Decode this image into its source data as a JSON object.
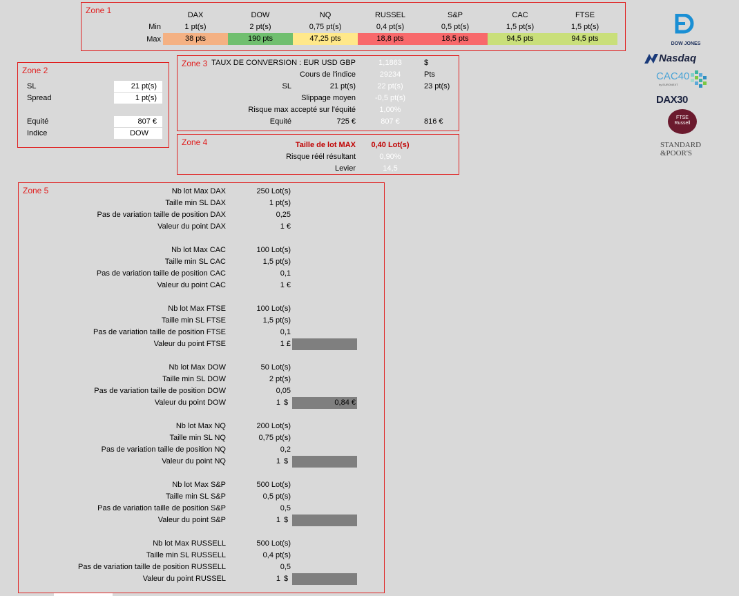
{
  "zone1": {
    "title": "Zone 1",
    "min_label": "Min",
    "max_label": "Max",
    "columns": [
      {
        "name": "DAX",
        "min": "1 pt(s)",
        "max": "38 pts",
        "color": "#f4b183"
      },
      {
        "name": "DOW",
        "min": "2 pt(s)",
        "max": "190 pts",
        "color": "#70bf6f"
      },
      {
        "name": "NQ",
        "min": "0,75 pt(s)",
        "max": "47,25 pts",
        "color": "#ffe88a"
      },
      {
        "name": "RUSSEL",
        "min": "0,4 pt(s)",
        "max": "18,8 pts",
        "color": "#f8696b"
      },
      {
        "name": "S&P",
        "min": "0,5 pt(s)",
        "max": "18,5 pts",
        "color": "#f8696b"
      },
      {
        "name": "CAC",
        "min": "1,5 pt(s)",
        "max": "94,5 pts",
        "color": "#c9df7a"
      },
      {
        "name": "FTSE",
        "min": "1,5 pt(s)",
        "max": "94,5 pts",
        "color": "#c9df7a"
      }
    ]
  },
  "zone2": {
    "title": "Zone 2",
    "sl_label": "SL",
    "sl_value": "21 pt(s)",
    "spread_label": "Spread",
    "spread_value": "1 pt(s)",
    "equite_label": "Equité",
    "equite_value": "807 €",
    "indice_label": "Indice",
    "indice_value": "DOW"
  },
  "zone3": {
    "title": "Zone 3",
    "conv_label": "TAUX DE CONVERSION : EUR USD GBP",
    "conv_value": "1,1863",
    "conv_unit": "$",
    "cours_label": "Cours de l'indice",
    "cours_value": "29234",
    "cours_unit": "Pts",
    "sl_label": "SL",
    "sl_a": "21 pt(s)",
    "sl_b": "22 pt(s)",
    "sl_c": "23 pt(s)",
    "slip_label": "Slippage moyen",
    "slip_value": "-0,5 pt(s)",
    "risk_label": "Risque max accepté sur l'équité",
    "risk_value": "1,00%",
    "eq_label": "Equité",
    "eq_a": "725 €",
    "eq_b": "807 €",
    "eq_c": "816 €"
  },
  "zone4": {
    "title": "Zone 4",
    "lot_label": "Taille de lot MAX",
    "lot_value": "0,40 Lot(s)",
    "risk_label": "Risque réél résultant",
    "risk_value": "0,90%",
    "lev_label": "Levier",
    "lev_value": "14,5"
  },
  "zone5": {
    "title": "Zone 5",
    "groups": [
      {
        "rows": [
          {
            "label": "Nb lot Max DAX",
            "value": "250 Lot(s)"
          },
          {
            "label": "Taille min SL DAX",
            "value": "1 pt(s)"
          },
          {
            "label": "Pas de variation taille de position DAX",
            "value": "0,25"
          },
          {
            "label": "Valeur du point DAX",
            "value": "1 €",
            "unit": "",
            "extra": ""
          }
        ],
        "gray": false
      },
      {
        "rows": [
          {
            "label": "Nb lot Max CAC",
            "value": "100 Lot(s)"
          },
          {
            "label": "Taille min SL CAC",
            "value": "1,5 pt(s)"
          },
          {
            "label": "Pas de variation taille de position CAC",
            "value": "0,1"
          },
          {
            "label": "Valeur du point CAC",
            "value": "1 €",
            "unit": "",
            "extra": ""
          }
        ],
        "gray": false
      },
      {
        "rows": [
          {
            "label": "Nb lot Max FTSE",
            "value": "100 Lot(s)"
          },
          {
            "label": "Taille min SL FTSE",
            "value": "1,5 pt(s)"
          },
          {
            "label": "Pas de variation taille de position FTSE",
            "value": "0,1"
          },
          {
            "label": "Valeur du point FTSE",
            "value": "1 £",
            "unit": "",
            "extra": ""
          }
        ],
        "gray": true
      },
      {
        "rows": [
          {
            "label": "Nb lot Max DOW",
            "value": "50 Lot(s)"
          },
          {
            "label": "Taille min SL DOW",
            "value": "2 pt(s)"
          },
          {
            "label": "Pas de variation taille de position DOW",
            "value": "0,05"
          },
          {
            "label": "Valeur du point DOW",
            "value": "1",
            "unit": "$",
            "extra": "0,84 €"
          }
        ],
        "gray": true
      },
      {
        "rows": [
          {
            "label": "Nb lot Max NQ",
            "value": "200 Lot(s)"
          },
          {
            "label": "Taille min SL NQ",
            "value": "0,75 pt(s)"
          },
          {
            "label": "Pas de variation taille de position NQ",
            "value": "0,2"
          },
          {
            "label": "Valeur du point NQ",
            "value": "1",
            "unit": "$",
            "extra": ""
          }
        ],
        "gray": true
      },
      {
        "rows": [
          {
            "label": "Nb lot Max S&P",
            "value": "500 Lot(s)"
          },
          {
            "label": "Taille min SL S&P",
            "value": "0,5 pt(s)"
          },
          {
            "label": "Pas de variation taille de position S&P",
            "value": "0,5"
          },
          {
            "label": "Valeur du point S&P",
            "value": "1",
            "unit": "$",
            "extra": ""
          }
        ],
        "gray": true
      },
      {
        "rows": [
          {
            "label": "Nb lot Max RUSSELL",
            "value": "500 Lot(s)"
          },
          {
            "label": "Taille min SL RUSSELL",
            "value": "0,4 pt(s)"
          },
          {
            "label": "Pas de variation taille de position RUSSELL",
            "value": "0,5"
          },
          {
            "label": "Valeur du point RUSSEL",
            "value": "1",
            "unit": "$",
            "extra": ""
          }
        ],
        "gray": true
      }
    ]
  },
  "logos": {
    "dowjones": "DOW JONES",
    "nasdaq": "Nasdaq",
    "cac": "CAC40",
    "cac_sub": "by EURONEXT",
    "dax": "DAX30",
    "ftse1": "FTSE",
    "ftse2": "Russell",
    "sp1": "STANDARD",
    "sp2": "&POOR'S"
  }
}
